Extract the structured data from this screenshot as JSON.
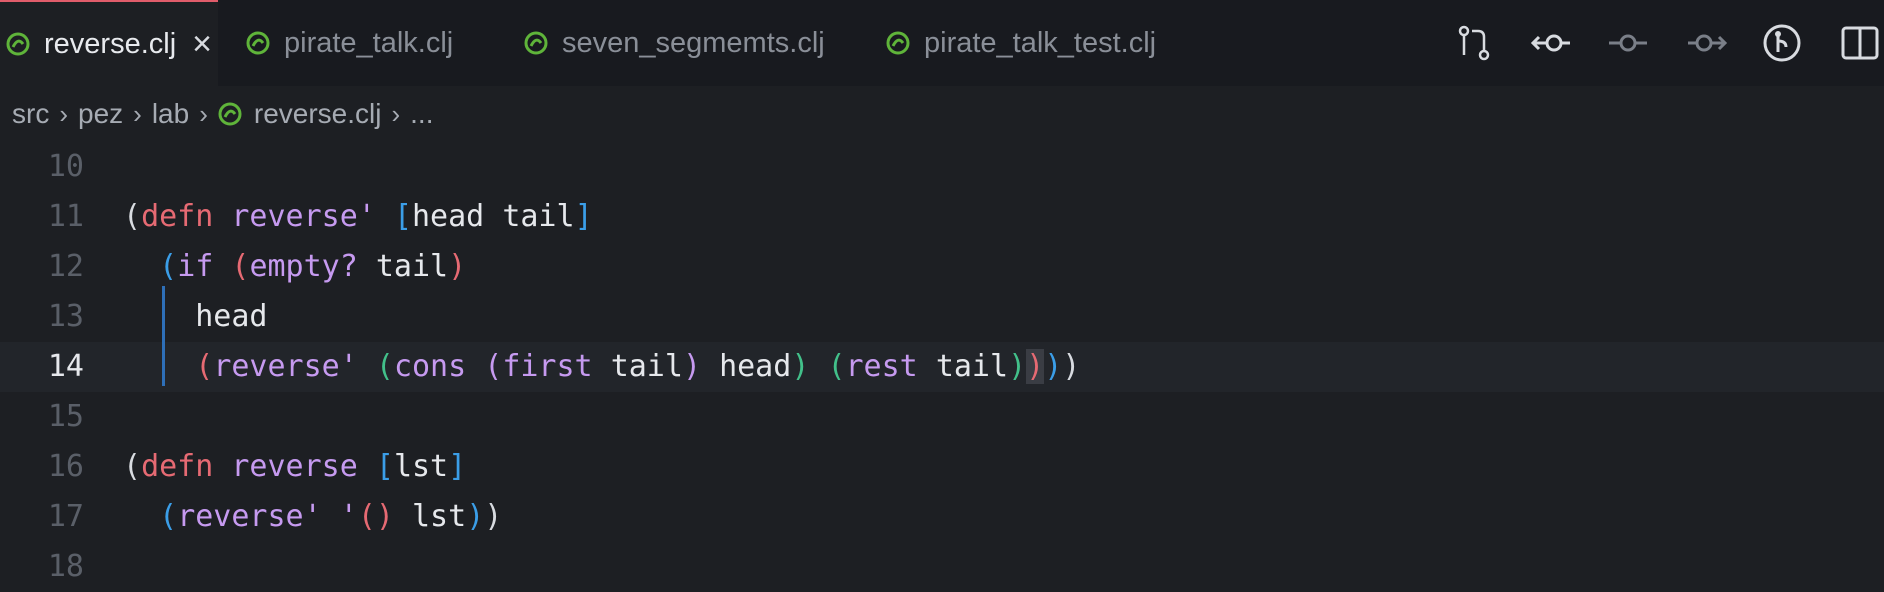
{
  "tabs": [
    {
      "label": "reverse.clj",
      "active": true
    },
    {
      "label": "pirate_talk.clj",
      "active": false
    },
    {
      "label": "seven_segmemts.clj",
      "active": false
    },
    {
      "label": "pirate_talk_test.clj",
      "active": false
    }
  ],
  "close_glyph": "×",
  "breadcrumb": {
    "items": [
      "src",
      "pez",
      "lab",
      "reverse.clj",
      "..."
    ],
    "separator": "›"
  },
  "lines": [
    {
      "number": "10"
    },
    {
      "number": "11"
    },
    {
      "number": "12"
    },
    {
      "number": "13"
    },
    {
      "number": "14"
    },
    {
      "number": "15"
    },
    {
      "number": "16"
    },
    {
      "number": "17"
    },
    {
      "number": "18"
    }
  ],
  "code_tokens": {
    "defn": "defn",
    "reverse_prime": "reverse'",
    "reverse": "reverse",
    "head": "head",
    "tail": "tail",
    "if": "if",
    "empty": "empty?",
    "cons": "cons",
    "first": "first",
    "rest": "rest",
    "lst": "lst",
    "empty_list_quote": "'",
    "prime": "'"
  },
  "colors": {
    "accent_tab": "#e05c6a",
    "clojure_icon": "#5fb43a"
  }
}
